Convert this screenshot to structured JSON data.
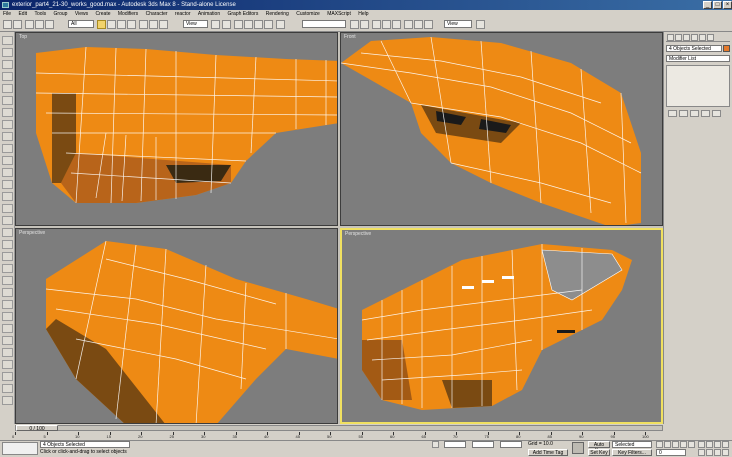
{
  "window": {
    "title": "exterior_part4_21-30_works_good.max - Autodesk 3ds Max 8 - Stand-alone License",
    "minimize": "_",
    "maximize": "□",
    "close": "×"
  },
  "menu": [
    "File",
    "Edit",
    "Tools",
    "Group",
    "Views",
    "Create",
    "Modifiers",
    "Character",
    "reactor",
    "Animation",
    "Graph Editors",
    "Rendering",
    "Customize",
    "MAXScript",
    "Help"
  ],
  "toolbar": {
    "filter_value": "All",
    "refcoord_value": "View",
    "selset_value": "",
    "view_value": "View"
  },
  "viewports": [
    {
      "label": "Top",
      "active": false
    },
    {
      "label": "Front",
      "active": false
    },
    {
      "label": "Perspective",
      "active": false
    },
    {
      "label": "Perspective",
      "active": true
    }
  ],
  "command_panel": {
    "object_name": "4 Objects Selected",
    "modifier_list": "Modifier List",
    "color_swatch": "#e57a2c"
  },
  "timeline": {
    "frame_label": "0 / 100",
    "ticks": [
      "0",
      "5",
      "10",
      "15",
      "20",
      "25",
      "30",
      "35",
      "40",
      "45",
      "50",
      "55",
      "60",
      "65",
      "70",
      "75",
      "80",
      "85",
      "90",
      "95",
      "100"
    ]
  },
  "status": {
    "selection": "4 Objects Selected",
    "prompt": "Click or click-and-drag to select objects",
    "grid": "Grid = 10.0",
    "add_time_tag": "Add Time Tag",
    "auto_key": "Auto Key",
    "set_key": "Set Key",
    "key_mode_value": "Selected",
    "key_filters": "Key Filters...",
    "frame_value": "0"
  },
  "colors": {
    "mesh": "#ee8a14",
    "mesh_dark": "#7a4a12",
    "wire": "#ffffff",
    "viewport_bg": "#7d7d7d",
    "active_border": "#f0e060"
  }
}
